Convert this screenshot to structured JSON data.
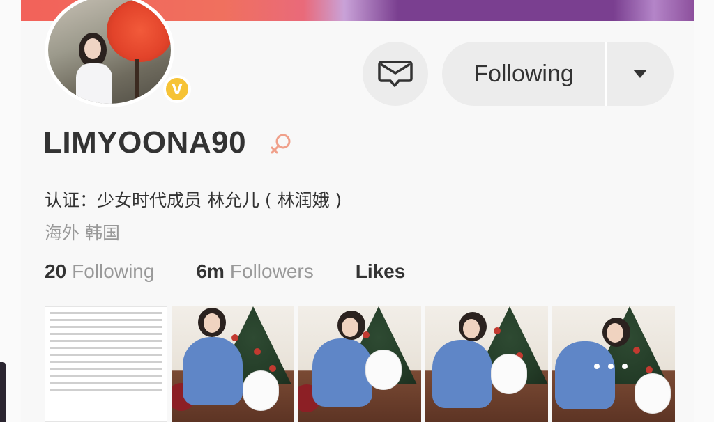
{
  "profile": {
    "username": "LIMYOONA90",
    "badge_letter": "V",
    "verification": "认证：少女时代成员 林允儿 ( 林润娥 )",
    "location": "海外 韩国"
  },
  "actions": {
    "follow_label": "Following"
  },
  "stats": {
    "following_count": "20",
    "following_label": "Following",
    "followers_count": "6m",
    "followers_label": "Followers",
    "likes_label": "Likes"
  },
  "colors": {
    "accent_badge": "#f6c336",
    "gender_icon": "#f0a08a",
    "banner_red": "#f2625a",
    "banner_purple": "#7a3f90"
  },
  "icons": {
    "message": "envelope-speech-icon",
    "dropdown": "caret-down-icon",
    "gender": "female-gender-icon",
    "verified": "verified-v-badge-icon"
  }
}
